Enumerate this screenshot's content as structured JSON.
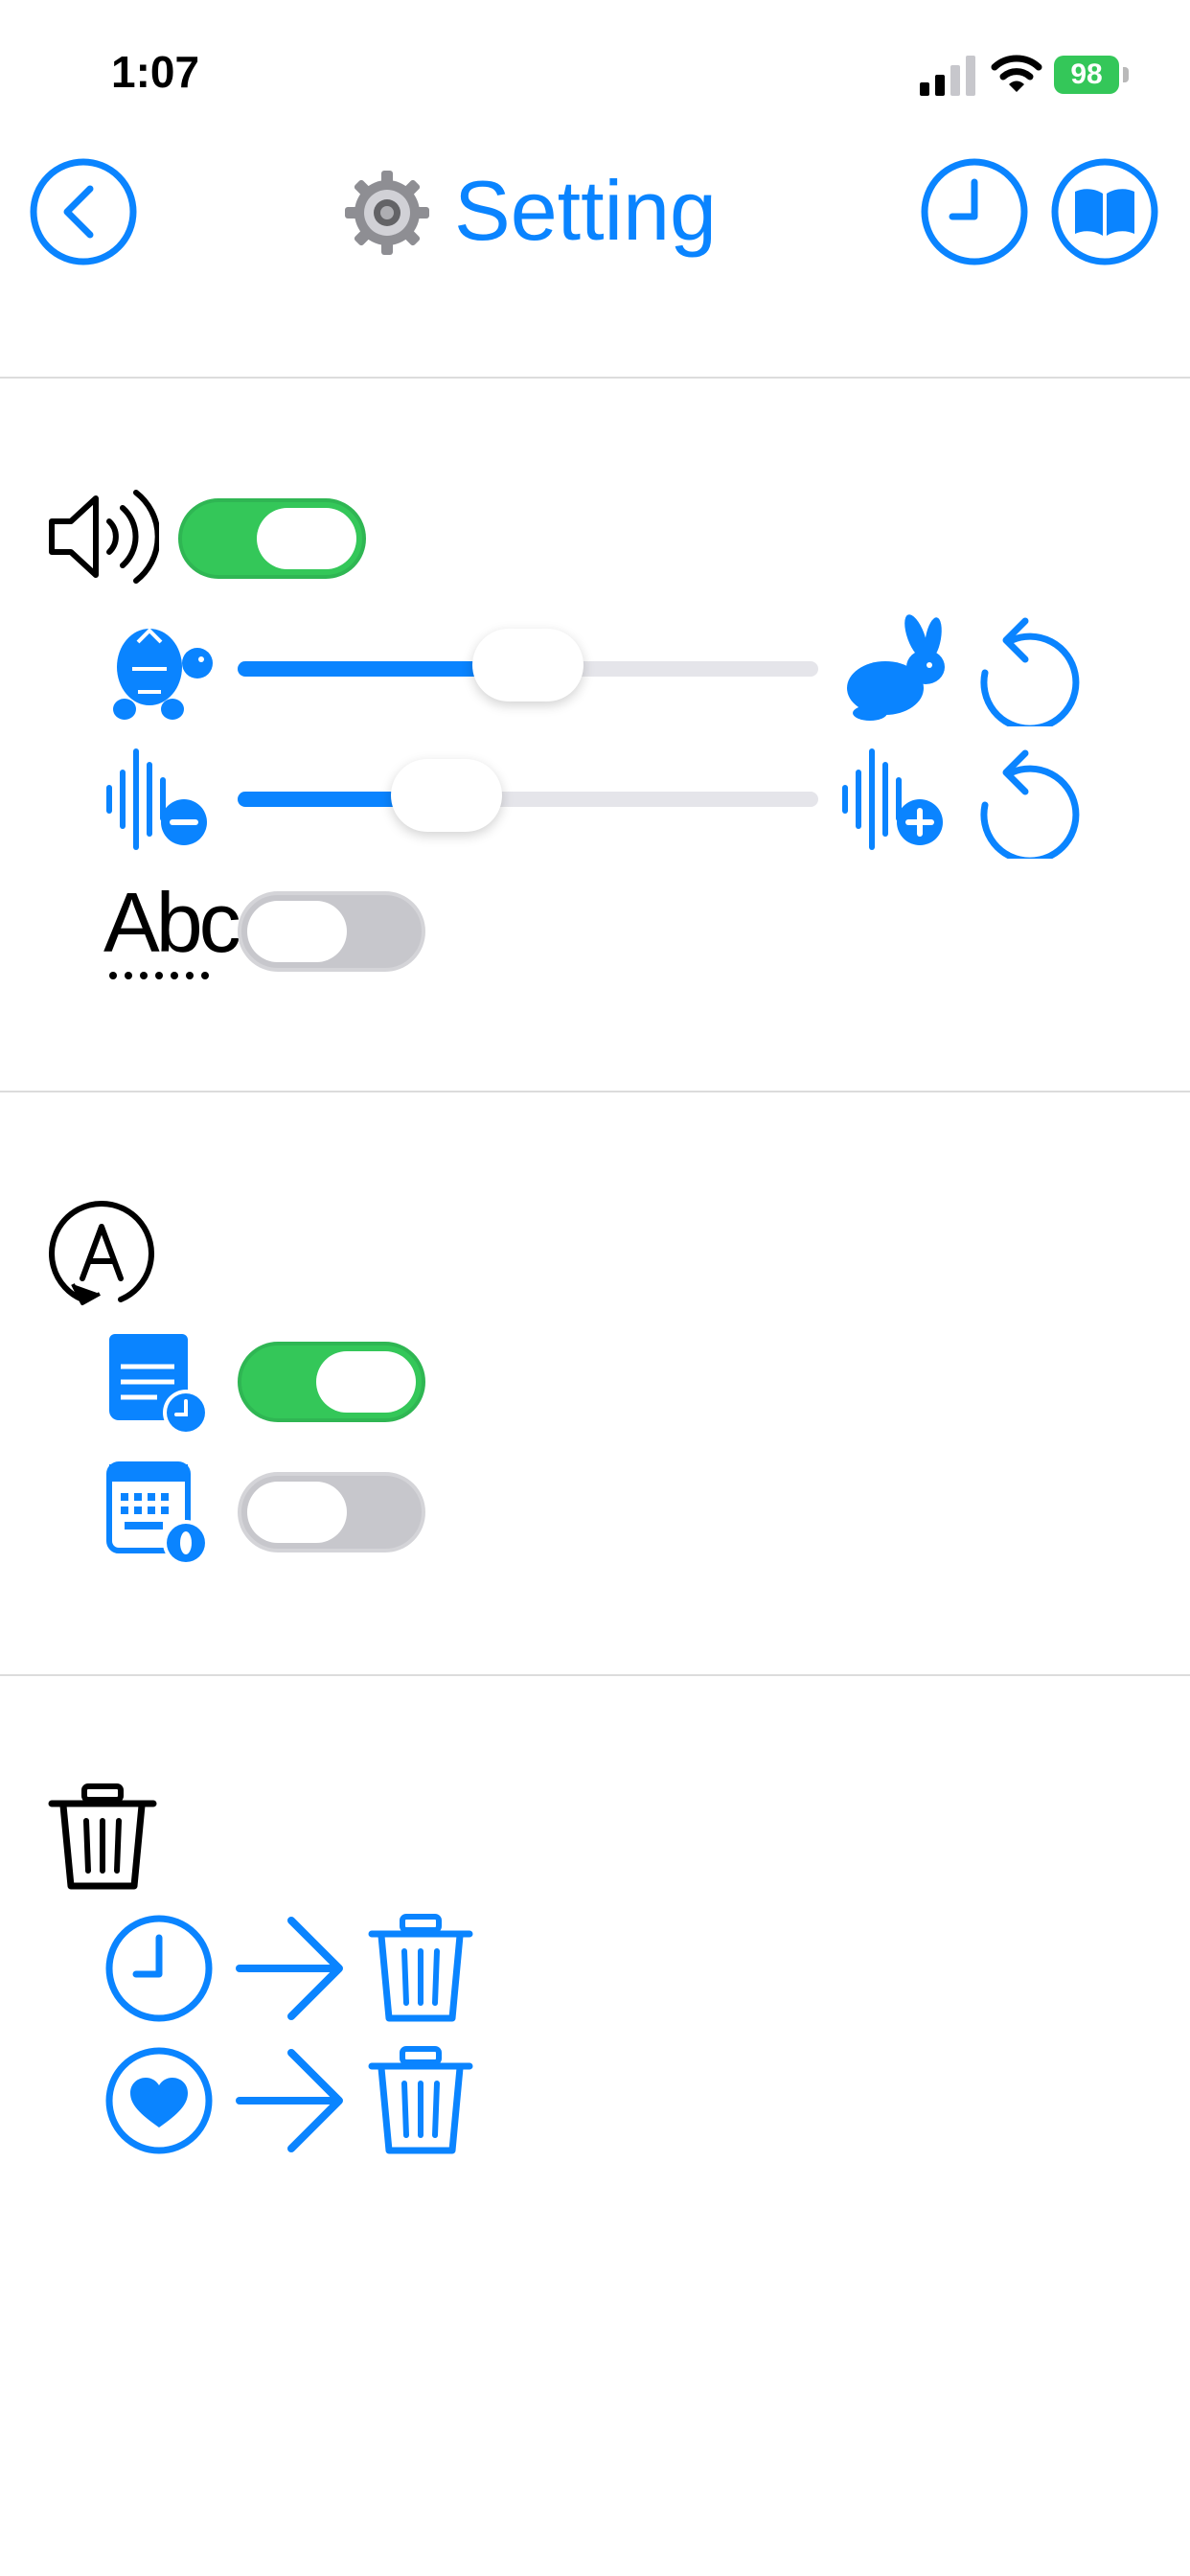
{
  "status_bar": {
    "time": "1:07",
    "battery": "98"
  },
  "header": {
    "title": "Setting"
  },
  "speech": {
    "enabled": true,
    "rate_percent": 50,
    "volume_percent": 36,
    "text_label": "Abc",
    "text_enabled": false
  },
  "auto": {
    "history_enabled": true,
    "keyboard_enabled": false
  },
  "colors": {
    "accent": "#0a84ff",
    "on": "#34c759",
    "off": "#c7c7cc"
  }
}
